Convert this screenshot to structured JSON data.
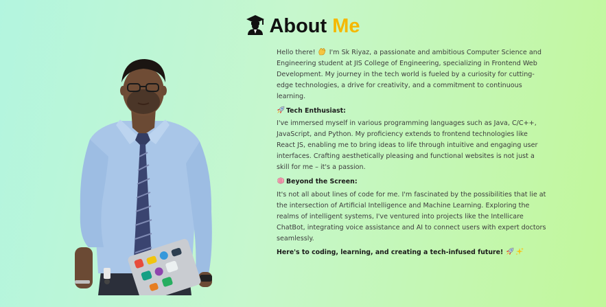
{
  "header": {
    "icon": "graduate-icon",
    "title_main": "About ",
    "title_accent": "Me",
    "accent_color": "#f5b800"
  },
  "photo": {
    "icon": "profile-photo"
  },
  "about": {
    "intro_before_emoji": "Hello there! ",
    "intro_emoji": "wave-icon",
    "intro_after_emoji": " I'm Sk Riyaz, a passionate and ambitious Computer Science and Engineering student at JIS College of Engineering, specializing in Frontend Web Development. My journey in the tech world is fueled by a curiosity for cutting-edge technologies, a drive for creativity, and a commitment to continuous learning.",
    "section1": {
      "icon": "rocket-icon",
      "title": "Tech Enthusiast",
      "body": "I've immersed myself in various programming languages such as Java, C/C++, JavaScript, and Python. My proficiency extends to frontend technologies like React JS, enabling me to bring ideas to life through intuitive and engaging user interfaces. Crafting aesthetically pleasing and functional websites is not just a skill for me – it's a passion."
    },
    "section2": {
      "icon": "brain-icon",
      "title": "Beyond the Screen",
      "body": "It's not all about lines of code for me. I'm fascinated by the possibilities that lie at the intersection of Artificial Intelligence and Machine Learning. Exploring the realms of intelligent systems, I've ventured into projects like the Intellicare ChatBot, integrating voice assistance and AI to connect users with expert doctors seamlessly."
    },
    "closing": "Here's to coding, learning, and creating a tech-infused future!",
    "closing_icons": [
      "rocket-icon",
      "sparkles-icon"
    ]
  }
}
